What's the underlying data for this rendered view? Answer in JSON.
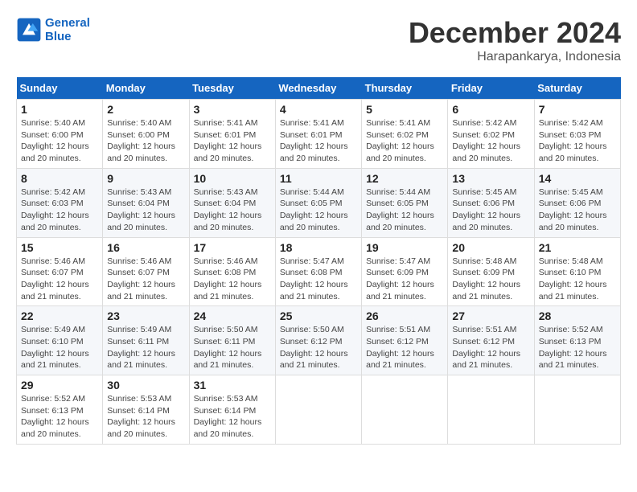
{
  "logo": {
    "line1": "General",
    "line2": "Blue"
  },
  "title": {
    "month": "December 2024",
    "location": "Harapankarya, Indonesia"
  },
  "headers": [
    "Sunday",
    "Monday",
    "Tuesday",
    "Wednesday",
    "Thursday",
    "Friday",
    "Saturday"
  ],
  "weeks": [
    [
      {
        "day": "1",
        "sunrise": "5:40 AM",
        "sunset": "6:00 PM",
        "daylight": "12 hours and 20 minutes."
      },
      {
        "day": "2",
        "sunrise": "5:40 AM",
        "sunset": "6:00 PM",
        "daylight": "12 hours and 20 minutes."
      },
      {
        "day": "3",
        "sunrise": "5:41 AM",
        "sunset": "6:01 PM",
        "daylight": "12 hours and 20 minutes."
      },
      {
        "day": "4",
        "sunrise": "5:41 AM",
        "sunset": "6:01 PM",
        "daylight": "12 hours and 20 minutes."
      },
      {
        "day": "5",
        "sunrise": "5:41 AM",
        "sunset": "6:02 PM",
        "daylight": "12 hours and 20 minutes."
      },
      {
        "day": "6",
        "sunrise": "5:42 AM",
        "sunset": "6:02 PM",
        "daylight": "12 hours and 20 minutes."
      },
      {
        "day": "7",
        "sunrise": "5:42 AM",
        "sunset": "6:03 PM",
        "daylight": "12 hours and 20 minutes."
      }
    ],
    [
      {
        "day": "8",
        "sunrise": "5:42 AM",
        "sunset": "6:03 PM",
        "daylight": "12 hours and 20 minutes."
      },
      {
        "day": "9",
        "sunrise": "5:43 AM",
        "sunset": "6:04 PM",
        "daylight": "12 hours and 20 minutes."
      },
      {
        "day": "10",
        "sunrise": "5:43 AM",
        "sunset": "6:04 PM",
        "daylight": "12 hours and 20 minutes."
      },
      {
        "day": "11",
        "sunrise": "5:44 AM",
        "sunset": "6:05 PM",
        "daylight": "12 hours and 20 minutes."
      },
      {
        "day": "12",
        "sunrise": "5:44 AM",
        "sunset": "6:05 PM",
        "daylight": "12 hours and 20 minutes."
      },
      {
        "day": "13",
        "sunrise": "5:45 AM",
        "sunset": "6:06 PM",
        "daylight": "12 hours and 20 minutes."
      },
      {
        "day": "14",
        "sunrise": "5:45 AM",
        "sunset": "6:06 PM",
        "daylight": "12 hours and 20 minutes."
      }
    ],
    [
      {
        "day": "15",
        "sunrise": "5:46 AM",
        "sunset": "6:07 PM",
        "daylight": "12 hours and 21 minutes."
      },
      {
        "day": "16",
        "sunrise": "5:46 AM",
        "sunset": "6:07 PM",
        "daylight": "12 hours and 21 minutes."
      },
      {
        "day": "17",
        "sunrise": "5:46 AM",
        "sunset": "6:08 PM",
        "daylight": "12 hours and 21 minutes."
      },
      {
        "day": "18",
        "sunrise": "5:47 AM",
        "sunset": "6:08 PM",
        "daylight": "12 hours and 21 minutes."
      },
      {
        "day": "19",
        "sunrise": "5:47 AM",
        "sunset": "6:09 PM",
        "daylight": "12 hours and 21 minutes."
      },
      {
        "day": "20",
        "sunrise": "5:48 AM",
        "sunset": "6:09 PM",
        "daylight": "12 hours and 21 minutes."
      },
      {
        "day": "21",
        "sunrise": "5:48 AM",
        "sunset": "6:10 PM",
        "daylight": "12 hours and 21 minutes."
      }
    ],
    [
      {
        "day": "22",
        "sunrise": "5:49 AM",
        "sunset": "6:10 PM",
        "daylight": "12 hours and 21 minutes."
      },
      {
        "day": "23",
        "sunrise": "5:49 AM",
        "sunset": "6:11 PM",
        "daylight": "12 hours and 21 minutes."
      },
      {
        "day": "24",
        "sunrise": "5:50 AM",
        "sunset": "6:11 PM",
        "daylight": "12 hours and 21 minutes."
      },
      {
        "day": "25",
        "sunrise": "5:50 AM",
        "sunset": "6:12 PM",
        "daylight": "12 hours and 21 minutes."
      },
      {
        "day": "26",
        "sunrise": "5:51 AM",
        "sunset": "6:12 PM",
        "daylight": "12 hours and 21 minutes."
      },
      {
        "day": "27",
        "sunrise": "5:51 AM",
        "sunset": "6:12 PM",
        "daylight": "12 hours and 21 minutes."
      },
      {
        "day": "28",
        "sunrise": "5:52 AM",
        "sunset": "6:13 PM",
        "daylight": "12 hours and 21 minutes."
      }
    ],
    [
      {
        "day": "29",
        "sunrise": "5:52 AM",
        "sunset": "6:13 PM",
        "daylight": "12 hours and 20 minutes."
      },
      {
        "day": "30",
        "sunrise": "5:53 AM",
        "sunset": "6:14 PM",
        "daylight": "12 hours and 20 minutes."
      },
      {
        "day": "31",
        "sunrise": "5:53 AM",
        "sunset": "6:14 PM",
        "daylight": "12 hours and 20 minutes."
      },
      null,
      null,
      null,
      null
    ]
  ],
  "labels": {
    "sunrise_prefix": "Sunrise: ",
    "sunset_prefix": "Sunset: ",
    "daylight_prefix": "Daylight: "
  }
}
